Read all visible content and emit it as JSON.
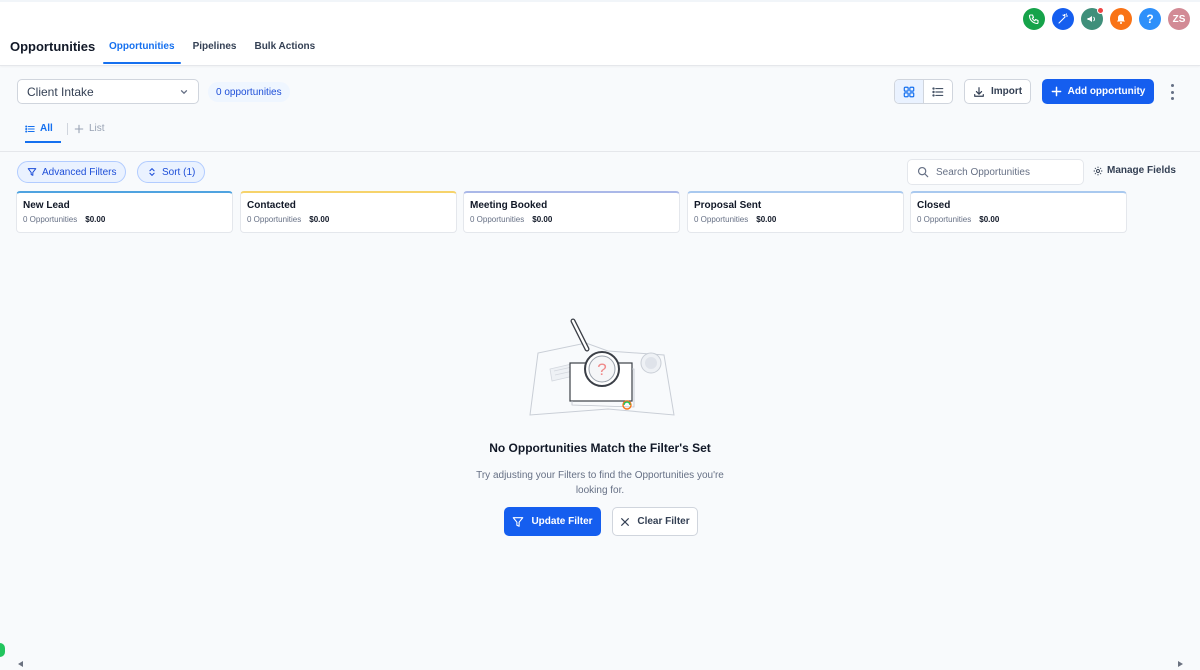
{
  "header": {
    "title": "Opportunities",
    "tabs": [
      {
        "label": "Opportunities",
        "active": true
      },
      {
        "label": "Pipelines",
        "active": false
      },
      {
        "label": "Bulk Actions",
        "active": false
      }
    ],
    "icons": [
      {
        "name": "phone-icon",
        "color": "#16a34a"
      },
      {
        "name": "magic-wand-icon",
        "color": "#155eef"
      },
      {
        "name": "megaphone-icon",
        "color": "#3f8f7a"
      },
      {
        "name": "bell-icon",
        "color": "#f97316"
      },
      {
        "name": "help-icon",
        "color": "#2e90fa",
        "glyph": "?"
      },
      {
        "name": "avatar",
        "color": "#d28a95",
        "initials": "ZS"
      }
    ]
  },
  "toolbar": {
    "pipeline_selected": "Client Intake",
    "count_label": "0 opportunities",
    "import_label": "Import",
    "add_label": "Add opportunity"
  },
  "subtabs": {
    "all_label": "All",
    "list_label": "List"
  },
  "filters": {
    "advanced_label": "Advanced Filters",
    "sort_label": "Sort (1)",
    "search_placeholder": "Search Opportunities",
    "manage_fields_label": "Manage Fields"
  },
  "stages": [
    {
      "title": "New Lead",
      "count": "0 Opportunities",
      "amount": "$0.00",
      "color": "#4fa3e0"
    },
    {
      "title": "Contacted",
      "count": "0 Opportunities",
      "amount": "$0.00",
      "color": "#f6d36b"
    },
    {
      "title": "Meeting Booked",
      "count": "0 Opportunities",
      "amount": "$0.00",
      "color": "#aab8e8"
    },
    {
      "title": "Proposal Sent",
      "count": "0 Opportunities",
      "amount": "$0.00",
      "color": "#a9c9ef"
    },
    {
      "title": "Closed",
      "count": "0 Opportunities",
      "amount": "$0.00",
      "color": "#a9c9ef"
    }
  ],
  "empty_state": {
    "title": "No Opportunities Match the Filter's Set",
    "description": "Try adjusting your Filters to find the Opportunities you're looking for.",
    "update_label": "Update Filter",
    "clear_label": "Clear Filter"
  }
}
